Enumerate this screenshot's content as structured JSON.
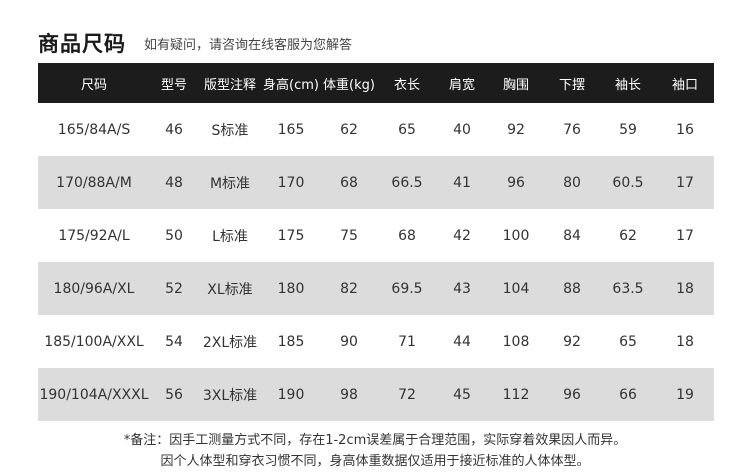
{
  "header": {
    "title": "商品尺码",
    "subtitle": "如有疑问，请咨询在线客服为您解答"
  },
  "table": {
    "columns": [
      "尺码",
      "型号",
      "版型注释",
      "身高(cm)",
      "体重(kg)",
      "衣长",
      "肩宽",
      "胸围",
      "下摆",
      "袖长",
      "袖口"
    ],
    "rows": [
      [
        "165/84A/S",
        "46",
        "S标准",
        "165",
        "62",
        "65",
        "40",
        "92",
        "76",
        "59",
        "16"
      ],
      [
        "170/88A/M",
        "48",
        "M标准",
        "170",
        "68",
        "66.5",
        "41",
        "96",
        "80",
        "60.5",
        "17"
      ],
      [
        "175/92A/L",
        "50",
        "L标准",
        "175",
        "75",
        "68",
        "42",
        "100",
        "84",
        "62",
        "17"
      ],
      [
        "180/96A/XL",
        "52",
        "XL标准",
        "180",
        "82",
        "69.5",
        "43",
        "104",
        "88",
        "63.5",
        "18"
      ],
      [
        "185/100A/XXL",
        "54",
        "2XL标准",
        "185",
        "90",
        "71",
        "44",
        "108",
        "92",
        "65",
        "18"
      ],
      [
        "190/104A/XXXL",
        "56",
        "3XL标准",
        "190",
        "98",
        "72",
        "45",
        "112",
        "96",
        "66",
        "19"
      ]
    ]
  },
  "notes": {
    "line1": "*备注：因手工测量方式不同，存在1-2cm误差属于合理范围，实际穿着效果因人而异。",
    "line2": "因个人体型和穿衣习惯不同，身高体重数据仅适用于接近标准的人体体型。"
  },
  "colors": {
    "header_bg": "#1c1c1c",
    "stripe_bg": "#dcdcdc"
  }
}
